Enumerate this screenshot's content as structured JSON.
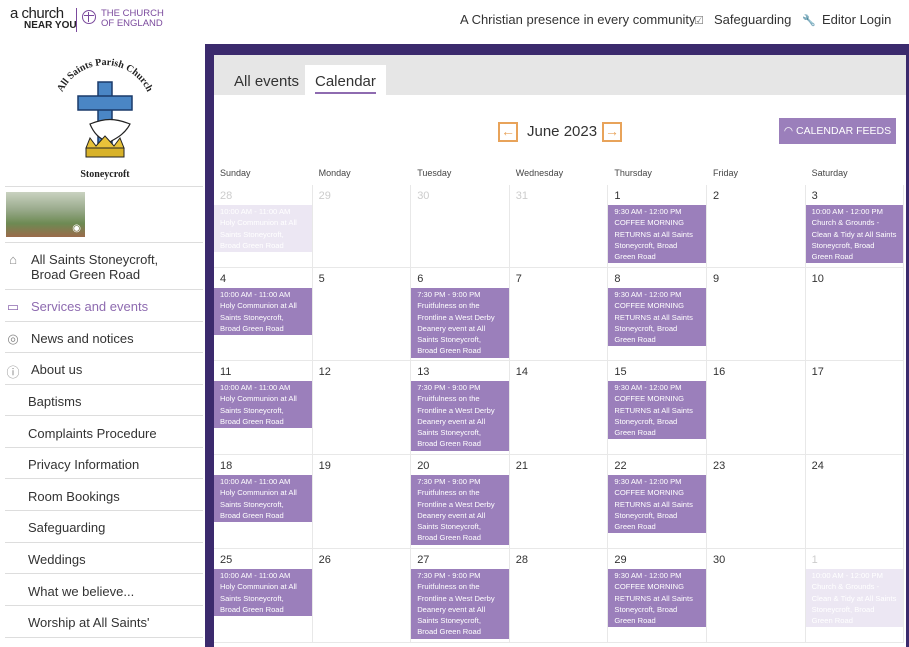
{
  "header": {
    "logo_line1": "a church",
    "logo_line2": "NEAR YOU",
    "coe_line1": "THE CHURCH",
    "coe_line2": "OF ENGLAND",
    "tagline": "A Christian presence in every community",
    "safeguarding": "Safeguarding",
    "editor_login": "Editor Login"
  },
  "sidebar": {
    "crest_arc_top": "All Saints Parish Church",
    "crest_bottom": "Stoneycroft",
    "location": "All Saints Stoneycroft, Broad Green Road",
    "items": [
      {
        "label": "Services and events",
        "icon": "calendar-icon",
        "active": true
      },
      {
        "label": "News and notices",
        "icon": "broadcast-icon",
        "active": false
      },
      {
        "label": "About us",
        "icon": "info-icon",
        "active": false
      }
    ],
    "subitems": [
      "Baptisms",
      "Complaints Procedure",
      "Privacy Information",
      "Room Bookings",
      "Safeguarding",
      "Weddings",
      "What we believe...",
      "Worship at All Saints'"
    ]
  },
  "tabs": {
    "all_events": "All events",
    "calendar": "Calendar"
  },
  "calendar": {
    "month": "June 2023",
    "prev_symbol": "←",
    "next_symbol": "→",
    "feeds_label": "CALENDAR FEEDS",
    "days_of_week": [
      "Sunday",
      "Monday",
      "Tuesday",
      "Wednesday",
      "Thursday",
      "Friday",
      "Saturday"
    ],
    "weeks": [
      [
        {
          "day": "28",
          "muted": true,
          "event": "10:00 AM - 11:00 AM Holy Communion at All Saints Stoneycroft, Broad Green Road"
        },
        {
          "day": "29",
          "muted": true,
          "event": ""
        },
        {
          "day": "30",
          "muted": true,
          "event": ""
        },
        {
          "day": "31",
          "muted": true,
          "event": ""
        },
        {
          "day": "1",
          "muted": false,
          "event": "9:30 AM - 12:00 PM COFFEE MORNING RETURNS at All Saints Stoneycroft, Broad Green Road"
        },
        {
          "day": "2",
          "muted": false,
          "event": ""
        },
        {
          "day": "3",
          "muted": false,
          "event": "10:00 AM - 12:00 PM Church & Grounds - Clean & Tidy at All Saints Stoneycroft, Broad Green Road"
        }
      ],
      [
        {
          "day": "4",
          "muted": false,
          "event": "10:00 AM - 11:00 AM Holy Communion at All Saints Stoneycroft, Broad Green Road"
        },
        {
          "day": "5",
          "muted": false,
          "event": ""
        },
        {
          "day": "6",
          "muted": false,
          "event": "7:30 PM - 9:00 PM Fruitfulness on the Frontline a West Derby Deanery event at All Saints Stoneycroft, Broad Green Road"
        },
        {
          "day": "7",
          "muted": false,
          "event": ""
        },
        {
          "day": "8",
          "muted": false,
          "event": "9:30 AM - 12:00 PM COFFEE MORNING RETURNS at All Saints Stoneycroft, Broad Green Road"
        },
        {
          "day": "9",
          "muted": false,
          "event": ""
        },
        {
          "day": "10",
          "muted": false,
          "event": ""
        }
      ],
      [
        {
          "day": "11",
          "muted": false,
          "event": "10:00 AM - 11:00 AM Holy Communion at All Saints Stoneycroft, Broad Green Road"
        },
        {
          "day": "12",
          "muted": false,
          "event": ""
        },
        {
          "day": "13",
          "muted": false,
          "event": "7:30 PM - 9:00 PM Fruitfulness on the Frontline a West Derby Deanery event at All Saints Stoneycroft, Broad Green Road"
        },
        {
          "day": "14",
          "muted": false,
          "event": ""
        },
        {
          "day": "15",
          "muted": false,
          "event": "9:30 AM - 12:00 PM COFFEE MORNING RETURNS at All Saints Stoneycroft, Broad Green Road"
        },
        {
          "day": "16",
          "muted": false,
          "event": ""
        },
        {
          "day": "17",
          "muted": false,
          "event": ""
        }
      ],
      [
        {
          "day": "18",
          "muted": false,
          "event": "10:00 AM - 11:00 AM Holy Communion at All Saints Stoneycroft, Broad Green Road"
        },
        {
          "day": "19",
          "muted": false,
          "event": ""
        },
        {
          "day": "20",
          "muted": false,
          "event": "7:30 PM - 9:00 PM Fruitfulness on the Frontline a West Derby Deanery event at All Saints Stoneycroft, Broad Green Road"
        },
        {
          "day": "21",
          "muted": false,
          "event": ""
        },
        {
          "day": "22",
          "muted": false,
          "event": "9:30 AM - 12:00 PM COFFEE MORNING RETURNS at All Saints Stoneycroft, Broad Green Road"
        },
        {
          "day": "23",
          "muted": false,
          "event": ""
        },
        {
          "day": "24",
          "muted": false,
          "event": ""
        }
      ],
      [
        {
          "day": "25",
          "muted": false,
          "event": "10:00 AM - 11:00 AM Holy Communion at All Saints Stoneycroft, Broad Green Road"
        },
        {
          "day": "26",
          "muted": false,
          "event": ""
        },
        {
          "day": "27",
          "muted": false,
          "event": "7:30 PM - 9:00 PM Fruitfulness on the Frontline a West Derby Deanery event at All Saints Stoneycroft, Broad Green Road"
        },
        {
          "day": "28",
          "muted": false,
          "event": ""
        },
        {
          "day": "29",
          "muted": false,
          "event": "9:30 AM - 12:00 PM COFFEE MORNING RETURNS at All Saints Stoneycroft, Broad Green Road"
        },
        {
          "day": "30",
          "muted": false,
          "event": ""
        },
        {
          "day": "1",
          "muted": true,
          "event": "10:00 AM - 12:00 PM Church & Grounds - Clean & Tidy at All Saints Stoneycroft, Broad Green Road"
        }
      ]
    ]
  },
  "colors": {
    "accent": "#9b7fbb",
    "frame": "#3b2a6d",
    "arrow": "#e8a35a"
  }
}
